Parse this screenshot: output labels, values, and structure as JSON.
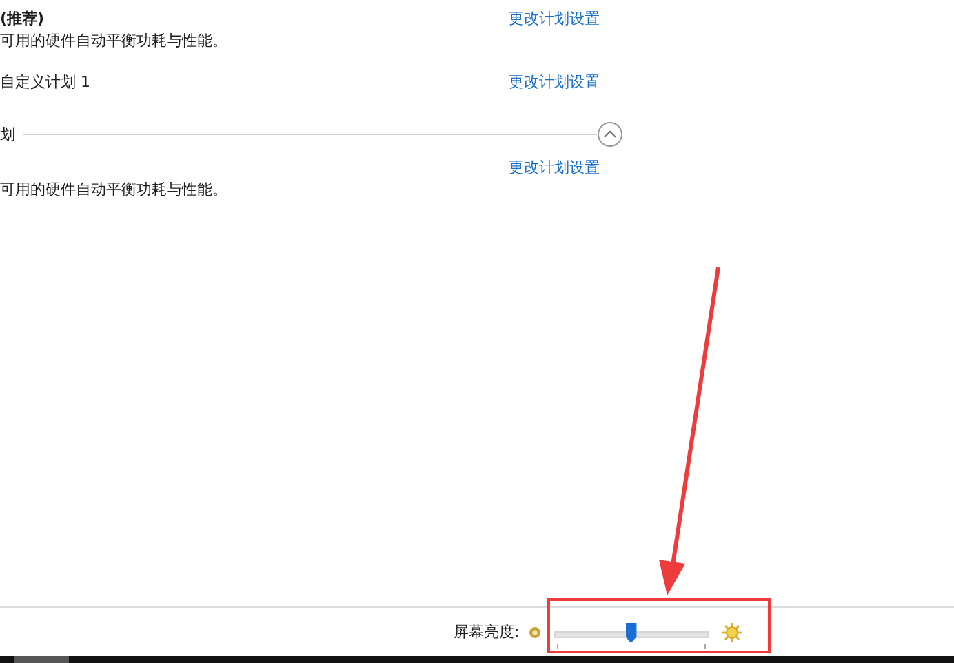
{
  "plans": [
    {
      "name": "(推荐)",
      "selected": true,
      "description": "可用的硬件自动平衡功耗与性能。",
      "link": "更改计划设置"
    },
    {
      "name": "自定义计划 1",
      "selected": false,
      "link": "更改计划设置"
    }
  ],
  "section": {
    "title": "划",
    "expanded": true
  },
  "hidden_plans": [
    {
      "link": "更改计划设置",
      "description": "可用的硬件自动平衡功耗与性能。"
    }
  ],
  "brightness": {
    "label": "屏幕亮度:",
    "level": 0.5
  }
}
